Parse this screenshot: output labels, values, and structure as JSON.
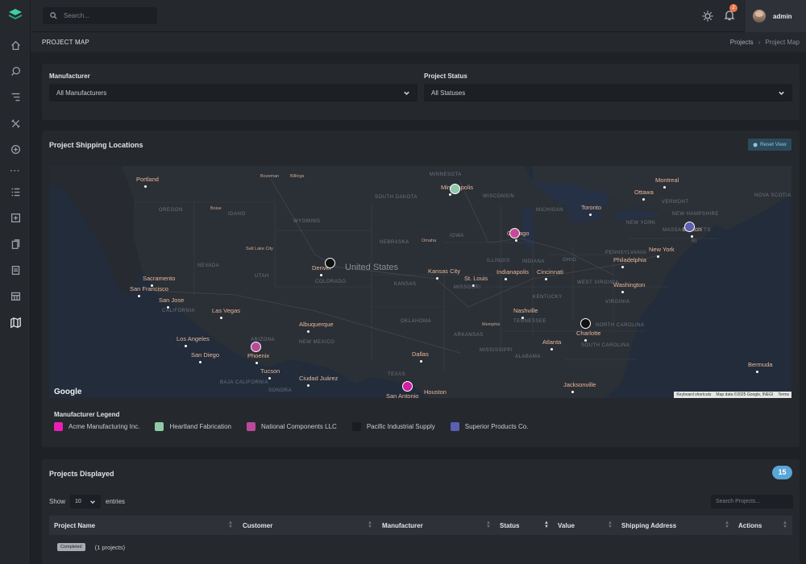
{
  "topbar": {
    "search_placeholder": "Search...",
    "notification_count": "2",
    "user_name": "admin"
  },
  "page": {
    "title": "PROJECT MAP",
    "breadcrumb": [
      "Projects",
      "Project Map"
    ]
  },
  "filters": {
    "manufacturer": {
      "label": "Manufacturer",
      "value": "All Manufacturers"
    },
    "status": {
      "label": "Project Status",
      "value": "All Statuses"
    }
  },
  "map_card": {
    "title": "Project Shipping Locations",
    "reset_label": "Reset View",
    "google_label": "Google",
    "footer": [
      "Keyboard shortcuts",
      "Map data ©2025 Google, INEGI",
      "Terms"
    ],
    "country_label": "United States",
    "cities": [
      {
        "name": "Portland"
      },
      {
        "name": "Sacramento"
      },
      {
        "name": "San Francisco"
      },
      {
        "name": "San Jose"
      },
      {
        "name": "Las Vegas"
      },
      {
        "name": "Los Angeles"
      },
      {
        "name": "San Diego"
      },
      {
        "name": "Phoenix"
      },
      {
        "name": "Tucson"
      },
      {
        "name": "Ciudad Juárez"
      },
      {
        "name": "Albuquerque"
      },
      {
        "name": "Denver"
      },
      {
        "name": "Minneapolis"
      },
      {
        "name": "Chicago"
      },
      {
        "name": "Kansas City"
      },
      {
        "name": "St. Louis"
      },
      {
        "name": "Indianapolis"
      },
      {
        "name": "Cincinnati"
      },
      {
        "name": "Nashville"
      },
      {
        "name": "Dallas"
      },
      {
        "name": "Houston"
      },
      {
        "name": "San Antonio"
      },
      {
        "name": "Atlanta"
      },
      {
        "name": "Charlotte"
      },
      {
        "name": "Jacksonville"
      },
      {
        "name": "Washington"
      },
      {
        "name": "Philadelphia"
      },
      {
        "name": "New York"
      },
      {
        "name": "Boston"
      },
      {
        "name": "Toronto"
      },
      {
        "name": "Ottawa"
      },
      {
        "name": "Montreal"
      },
      {
        "name": "Bermuda"
      }
    ],
    "small_cities": [
      "Boise",
      "Bozeman",
      "Billings",
      "Salt Lake City",
      "Omaha",
      "Memphis"
    ],
    "states": [
      "OREGON",
      "IDAHO",
      "WYOMING",
      "NEVADA",
      "UTAH",
      "COLORADO",
      "CALIFORNIA",
      "ARIZONA",
      "NEW MEXICO",
      "NEBRASKA",
      "KANSAS",
      "OKLAHOMA",
      "TEXAS",
      "SOUTH DAKOTA",
      "MINNESOTA",
      "WISCONSIN",
      "IOWA",
      "MISSOURI",
      "ILLINOIS",
      "INDIANA",
      "OHIO",
      "MICHIGAN",
      "ARKANSAS",
      "MISSISSIPPI",
      "ALABAMA",
      "TENNESSEE",
      "KENTUCKY",
      "WEST VIRGINIA",
      "VIRGINIA",
      "NORTH CAROLINA",
      "SOUTH CAROLINA",
      "PENNSYLVANIA",
      "NEW YORK",
      "VERMONT",
      "NEW HAMPSHIRE",
      "MASSACHUSETTS",
      "NOVA SCOTIA",
      "BAJA CALIFORNIA",
      "SONORA",
      "RI"
    ],
    "markers": [
      {
        "city": "Minneapolis",
        "color": "#8fc9a8"
      },
      {
        "city": "Chicago",
        "color": "#c8489a"
      },
      {
        "city": "Boston",
        "color": "#5a5fb0"
      },
      {
        "city": "Denver",
        "color": "#111111"
      },
      {
        "city": "Phoenix",
        "color": "#b94a9a"
      },
      {
        "city": "Charlotte",
        "color": "#111111"
      },
      {
        "city": "San Antonio",
        "color": "#d01fa3"
      }
    ]
  },
  "legend": {
    "title": "Manufacturer Legend",
    "items": [
      {
        "name": "Acme Manufacturing Inc.",
        "color": "#e81fb5"
      },
      {
        "name": "Heartland Fabrication",
        "color": "#8fc9a8"
      },
      {
        "name": "National Components LLC",
        "color": "#b94a9a"
      },
      {
        "name": "Pacific Industrial Supply",
        "color": "#1a1c20"
      },
      {
        "name": "Superior Products Co.",
        "color": "#5a5fb0"
      }
    ]
  },
  "projects": {
    "title": "Projects Displayed",
    "count": "15",
    "show_label": "Show",
    "entries_value": "10",
    "entries_label": "entries",
    "search_placeholder": "Search Projects...",
    "columns": [
      "Project Name",
      "Customer",
      "Manufacturer",
      "Status",
      "Value",
      "Shipping Address",
      "Actions"
    ],
    "group": {
      "status": "Completed",
      "count_text": "(1 projects)"
    }
  }
}
